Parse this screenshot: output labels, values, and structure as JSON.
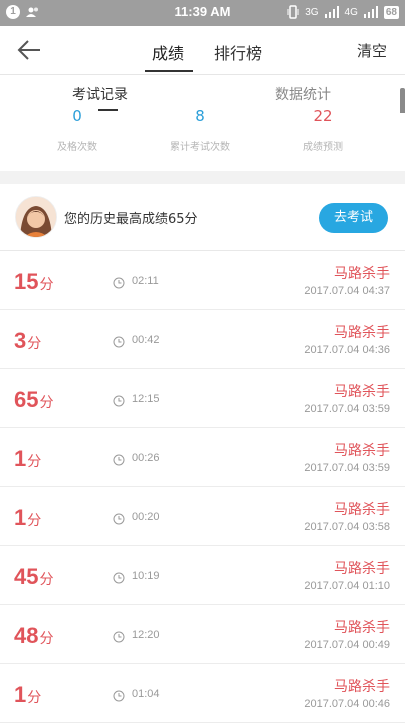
{
  "status_bar": {
    "notif_count": "1",
    "time": "11:39 AM",
    "signal_1": "3G",
    "signal_2": "4G",
    "battery": "68"
  },
  "nav": {
    "tabs": [
      "成绩",
      "排行榜"
    ],
    "active_tab": 0,
    "clear_label": "清空"
  },
  "sub_tabs": {
    "tabs": [
      "考试记录",
      "数据统计"
    ],
    "active_tab": 0
  },
  "stats": [
    {
      "value": "0",
      "label": "及格次数",
      "color": "#2c9fd9"
    },
    {
      "value": "8",
      "label": "累计考试次数",
      "color": "#2c9fd9"
    },
    {
      "value": "22",
      "label": "成绩预测",
      "color": "#e0545a"
    }
  ],
  "best": {
    "text": "您的历史最高成绩65分",
    "button": "去考试"
  },
  "unit": "分",
  "records": [
    {
      "score": "15",
      "duration": "02:11",
      "title": "马路杀手",
      "date": "2017.07.04  04:37"
    },
    {
      "score": "3",
      "duration": "00:42",
      "title": "马路杀手",
      "date": "2017.07.04  04:36"
    },
    {
      "score": "65",
      "duration": "12:15",
      "title": "马路杀手",
      "date": "2017.07.04  03:59"
    },
    {
      "score": "1",
      "duration": "00:26",
      "title": "马路杀手",
      "date": "2017.07.04  03:59"
    },
    {
      "score": "1",
      "duration": "00:20",
      "title": "马路杀手",
      "date": "2017.07.04  03:58"
    },
    {
      "score": "45",
      "duration": "10:19",
      "title": "马路杀手",
      "date": "2017.07.04  01:10"
    },
    {
      "score": "48",
      "duration": "12:20",
      "title": "马路杀手",
      "date": "2017.07.04  00:49"
    },
    {
      "score": "1",
      "duration": "01:04",
      "title": "马路杀手",
      "date": "2017.07.04  00:46"
    }
  ],
  "colors": {
    "accent_blue": "#28a7e1",
    "score_red": "#e0545a",
    "status_gray": "#9e9e9e"
  }
}
